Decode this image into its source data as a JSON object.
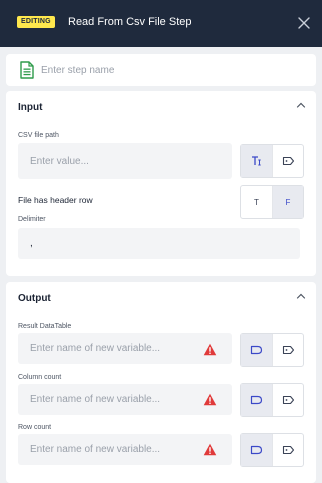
{
  "header": {
    "badge": "EDITING",
    "title": "Read From Csv File Step"
  },
  "step_name": {
    "placeholder": "Enter step name",
    "value": ""
  },
  "input_section": {
    "title": "Input",
    "csv_path": {
      "label": "CSV file path",
      "placeholder": "Enter value..."
    },
    "header_row": {
      "label": "File has header row",
      "true_label": "T",
      "false_label": "F",
      "selected": "F"
    },
    "delimiter": {
      "label": "Delimiter",
      "value": ","
    }
  },
  "output_section": {
    "title": "Output",
    "fields": [
      {
        "label": "Result DataTable",
        "placeholder": "Enter name of new variable..."
      },
      {
        "label": "Column count",
        "placeholder": "Enter name of new variable..."
      },
      {
        "label": "Row count",
        "placeholder": "Enter name of new variable..."
      }
    ]
  },
  "colors": {
    "header_bg": "#1f2a3d",
    "badge_bg": "#ffe84d",
    "accent": "#3b49c8",
    "warning": "#e03a3a",
    "file_icon": "#2e9b4a"
  },
  "icons": [
    "close-icon",
    "csv-file-icon",
    "chevron-up-icon",
    "text-type-icon",
    "variable-tag-icon",
    "warning-icon"
  ]
}
